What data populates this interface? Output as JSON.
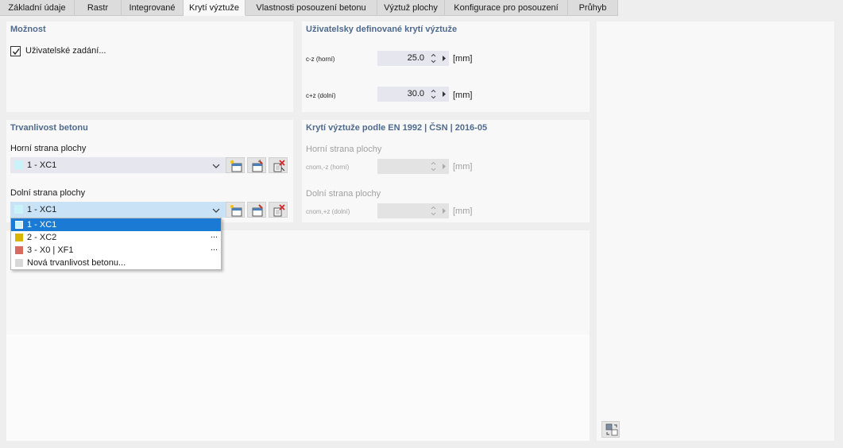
{
  "tabs": [
    {
      "label": "Základní údaje",
      "active": false
    },
    {
      "label": "Rastr",
      "active": false
    },
    {
      "label": "Integrované",
      "active": false
    },
    {
      "label": "Krytí výztuže",
      "active": true
    },
    {
      "label": "Vlastnosti posouzení betonu",
      "active": false
    },
    {
      "label": "Výztuž plochy",
      "active": false
    },
    {
      "label": "Konfigurace pro posouzení",
      "active": false
    },
    {
      "label": "Průhyb",
      "active": false
    }
  ],
  "moznost": {
    "title": "Možnost",
    "checkbox_label": "Uživatelské zadání...",
    "checked": true
  },
  "user_cover": {
    "title": "Uživatelsky definované krytí výztuže",
    "rows": [
      {
        "label": "c-z (horní)",
        "value": "25.0",
        "unit": "[mm]"
      },
      {
        "label": "c+z (dolní)",
        "value": "30.0",
        "unit": "[mm]"
      }
    ]
  },
  "durability": {
    "title": "Trvanlivost betonu",
    "top_label": "Horní strana plochy",
    "top_value": "1 - XC1",
    "bottom_label": "Dolní strana plochy",
    "bottom_value": "1 - XC1",
    "swatch_color": "#c8f3f8"
  },
  "dropdown": {
    "items": [
      {
        "label": "1 - XC1",
        "color": "#c8f3f8",
        "selected": true,
        "more": ""
      },
      {
        "label": "2 - XC2",
        "color": "#d9b500",
        "selected": false,
        "more": "..."
      },
      {
        "label": "3 - X0 | XF1",
        "color": "#d86b60",
        "selected": false,
        "more": "..."
      },
      {
        "label": "Nová trvanlivost betonu...",
        "color": "#d8d8d8",
        "selected": false,
        "more": ""
      }
    ]
  },
  "en_cover": {
    "title": "Krytí výztuže podle EN 1992 | ČSN | 2016-05",
    "top_label": "Horní strana plochy",
    "top_field": "cnom,-z (horní)",
    "bottom_label": "Dolní strana plochy",
    "bottom_field": "cnom,+z (dolní)",
    "unit": "[mm]"
  },
  "colors": {
    "title_blue": "#4f6a8d",
    "selection_blue": "#1a7ad4",
    "combo_open": "#c9e2f6"
  }
}
